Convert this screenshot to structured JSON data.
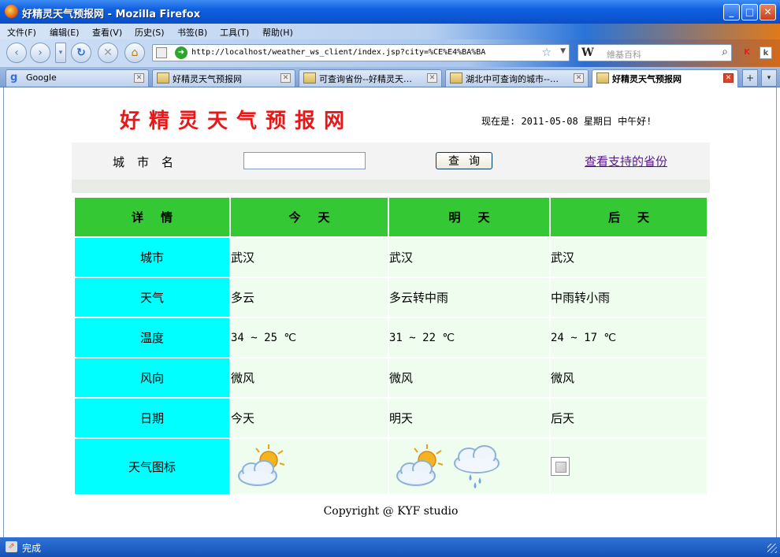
{
  "window": {
    "title": "好精灵天气预报网 - Mozilla Firefox",
    "minimize": "_",
    "maximize": "□",
    "close": "✕"
  },
  "menubar": [
    "文件(F)",
    "编辑(E)",
    "查看(V)",
    "历史(S)",
    "书签(B)",
    "工具(T)",
    "帮助(H)"
  ],
  "navbar": {
    "url": "http://localhost/weather_ws_client/index.jsp?city=%CE%E4%BA%BA",
    "search_placeholder": "維基百科",
    "search_engine": "W"
  },
  "tabs": [
    {
      "label": "Google",
      "active": false
    },
    {
      "label": "好精灵天气预报网",
      "active": false
    },
    {
      "label": "可查询省份--好精灵天…",
      "active": false
    },
    {
      "label": "湖北中可查询的城市--…",
      "active": false
    },
    {
      "label": "好精灵天气预报网",
      "active": true
    }
  ],
  "page": {
    "site_title": "好精灵天气预报网",
    "date_line": "现在是: 2011-05-08 星期日 中午好!",
    "city_label": "城市名",
    "city_input_value": "",
    "query_button": "查询",
    "provinces_link": "查看支持的省份",
    "table": {
      "headers": [
        "详情",
        "今天",
        "明天",
        "后天"
      ],
      "rows": [
        {
          "label": "城市",
          "values": [
            "武汉",
            "武汉",
            "武汉"
          ]
        },
        {
          "label": "天气",
          "values": [
            "多云",
            "多云转中雨",
            "中雨转小雨"
          ]
        },
        {
          "label": "温度",
          "values": [
            "34 ~ 25 ℃",
            "31 ~ 22 ℃",
            "24 ~ 17 ℃"
          ]
        },
        {
          "label": "风向",
          "values": [
            "微风",
            "微风",
            "微风"
          ]
        },
        {
          "label": "日期",
          "values": [
            "今天",
            "明天",
            "后天"
          ]
        }
      ],
      "icon_row_label": "天气图标",
      "icons": [
        [
          "partly-cloudy-icon"
        ],
        [
          "partly-cloudy-icon",
          "rain-cloud-icon"
        ],
        [
          "broken-image-icon"
        ]
      ]
    },
    "copyright": "Copyright @ KYF studio"
  },
  "status": {
    "text": "完成"
  },
  "colors": {
    "title_red": "#e81818",
    "header_green": "#34c934",
    "rowhead_cyan": "#00ffff",
    "cell_bg": "#eefdee",
    "link_purple": "#551a8b"
  }
}
